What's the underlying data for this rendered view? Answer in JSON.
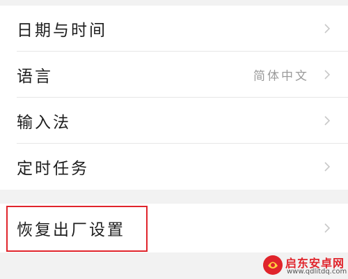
{
  "settings": {
    "items": [
      {
        "label": "日期与时间",
        "value": ""
      },
      {
        "label": "语言",
        "value": "简体中文"
      },
      {
        "label": "输入法",
        "value": ""
      },
      {
        "label": "定时任务",
        "value": ""
      }
    ],
    "reset": {
      "label": "恢复出厂设置"
    }
  },
  "icons": {
    "chevron": "chevron-right-icon"
  },
  "colors": {
    "background": "#f2f2f2",
    "card": "#ffffff",
    "label": "#1e1e1e",
    "value": "#9a9a9a",
    "chevron": "#c8c8c8",
    "highlight": "#e0242b"
  },
  "watermark": {
    "name": "启东安卓网",
    "url": "www.qdlitdq.com"
  }
}
